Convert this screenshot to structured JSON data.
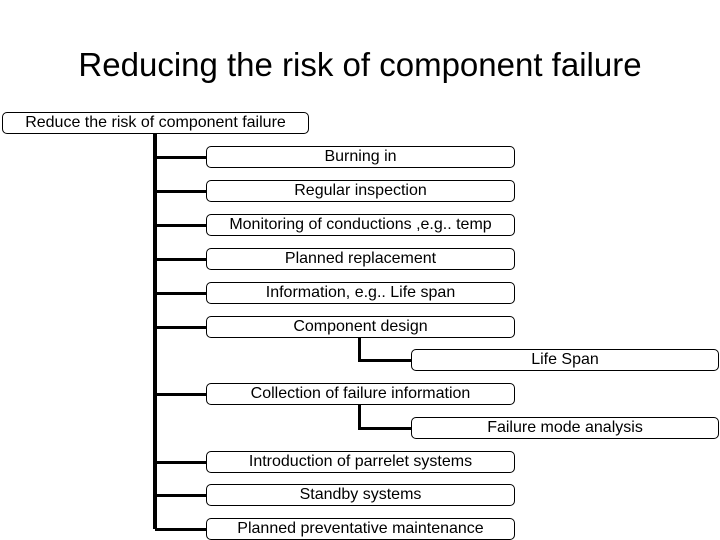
{
  "title": "Reducing the risk of component failure",
  "root": "Reduce the risk of component failure",
  "items": [
    {
      "label": "Burning in"
    },
    {
      "label": "Regular inspection"
    },
    {
      "label": "Monitoring of conductions ,e.g.. temp"
    },
    {
      "label": "Planned replacement"
    },
    {
      "label": "Information, e.g.. Life span"
    },
    {
      "label": "Component design",
      "child": "Life Span"
    },
    {
      "label": "Collection of failure information",
      "child": "Failure mode analysis"
    },
    {
      "label": "Introduction of parrelet systems"
    },
    {
      "label": "Standby systems"
    },
    {
      "label": "Planned preventative maintenance"
    }
  ]
}
